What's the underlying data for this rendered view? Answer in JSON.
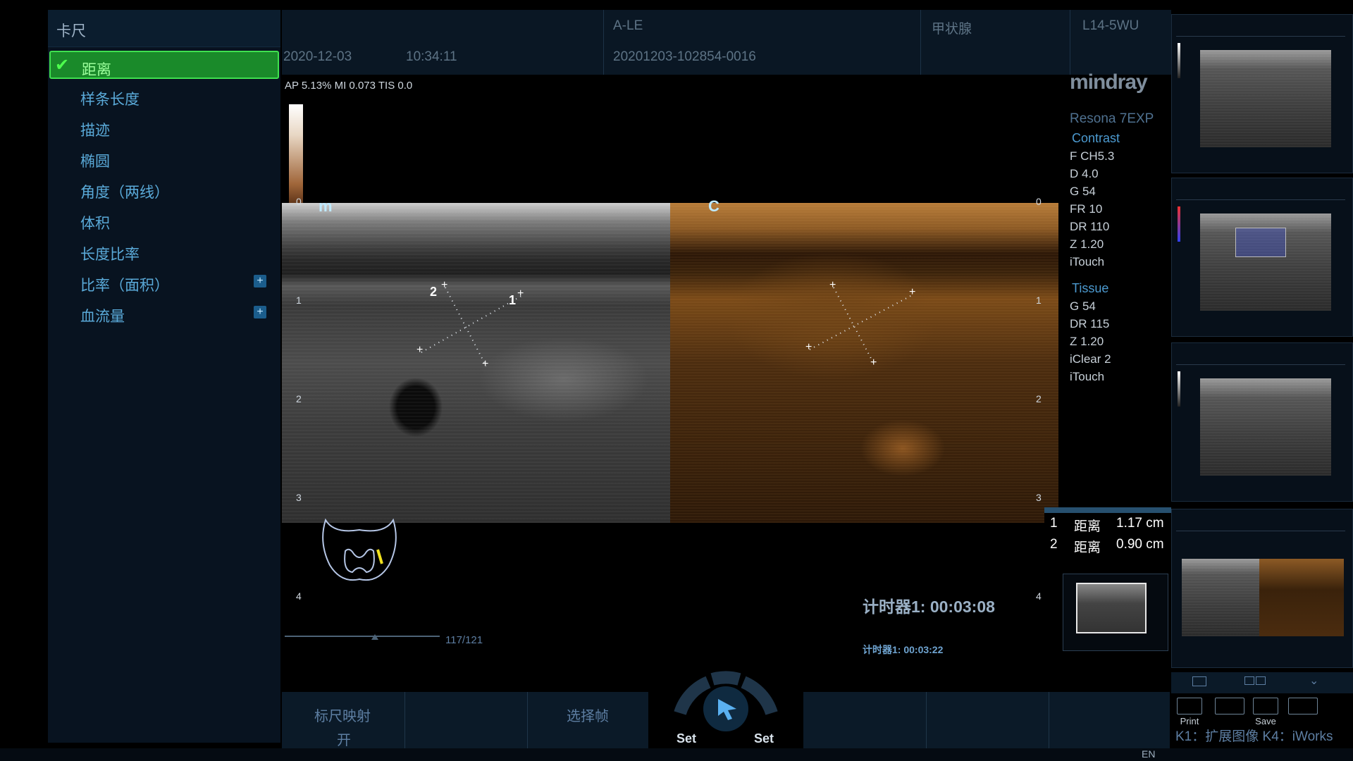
{
  "menu": {
    "title": "卡尺",
    "items": [
      {
        "label": "距离",
        "active": true,
        "plus": false
      },
      {
        "label": "样条长度",
        "active": false,
        "plus": false
      },
      {
        "label": "描迹",
        "active": false,
        "plus": false
      },
      {
        "label": "椭圆",
        "active": false,
        "plus": false
      },
      {
        "label": "角度（两线）",
        "active": false,
        "plus": false
      },
      {
        "label": "体积",
        "active": false,
        "plus": false
      },
      {
        "label": "长度比率",
        "active": false,
        "plus": false
      },
      {
        "label": "比率（面积）",
        "active": false,
        "plus": true
      },
      {
        "label": "血流量",
        "active": false,
        "plus": true
      }
    ]
  },
  "header": {
    "date": "2020-12-03",
    "time": "10:34:11",
    "patient_id": "A-LE",
    "exam_id": "20201203-102854-0016",
    "exam_type": "甲状腺",
    "probe": "L14-5WU"
  },
  "image": {
    "ap_line": "AP 5.13%  MI 0.073 TIS 0.0",
    "left_mode": "m",
    "right_mode": "C",
    "depth_ticks": [
      "0",
      "1",
      "2",
      "3",
      "4"
    ],
    "cine_text": "117/121",
    "marker_1": "1",
    "marker_2": "2"
  },
  "params": {
    "brand": "mindray",
    "model": "Resona 7EXP",
    "contrast_head": "Contrast",
    "contrast": [
      "F CH5.3",
      "D 4.0",
      "G 54",
      "FR 10",
      "DR 110",
      "Z 1.20",
      "iTouch"
    ],
    "tissue_head": "Tissue",
    "tissue": [
      "G 54",
      "DR 115",
      "Z 1.20",
      "iClear 2",
      "iTouch"
    ]
  },
  "results": [
    {
      "index": "1",
      "name": "距离",
      "value": "1.17 cm"
    },
    {
      "index": "2",
      "name": "距离",
      "value": "0.90 cm"
    }
  ],
  "timers": {
    "timer1": "计时器1: 00:03:08",
    "timer2": "计时器1: 00:03:22"
  },
  "softkeys": {
    "scale_map": "标尺映射",
    "scale_map_value": "开",
    "select_frame": "选择帧",
    "set_left": "Set",
    "set_right": "Set"
  },
  "tools": {
    "print": "Print",
    "save": "Save",
    "k_line": "K1：扩展图像   K4：iWorks"
  },
  "status": {
    "lang": "EN"
  },
  "icons": [
    "check-icon",
    "plus-icon",
    "pointer-icon",
    "print-icon",
    "save-icon",
    "single-view-icon",
    "dual-view-icon",
    "chevron-down-icon"
  ],
  "colors": {
    "active_green": "#1a8a2a",
    "menu_text": "#5aaad9",
    "header_bg": "#0a1724",
    "param_head": "#4c9ad0"
  }
}
